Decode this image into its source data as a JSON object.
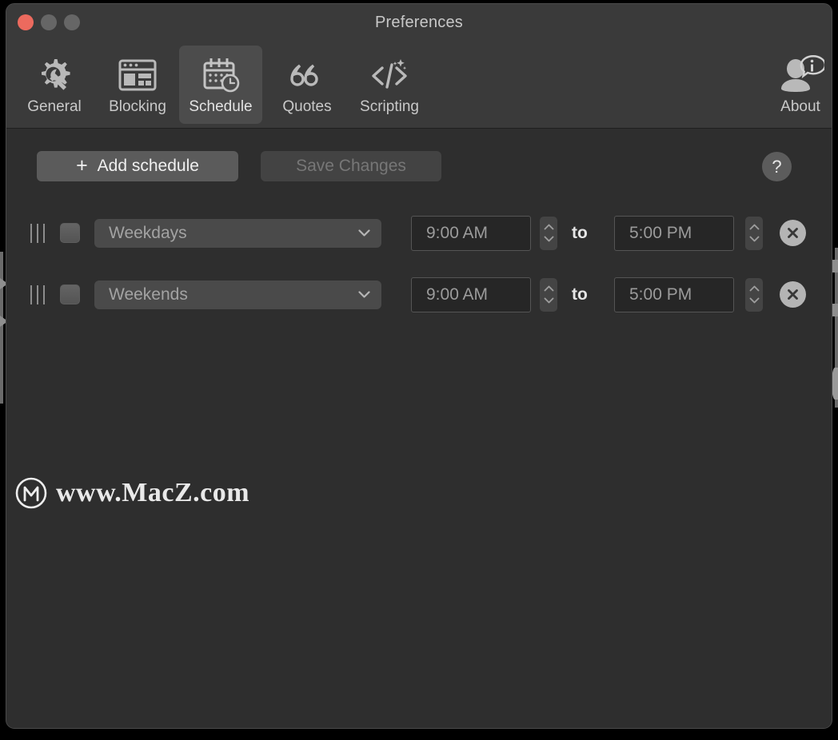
{
  "window": {
    "title": "Preferences",
    "traffic_lights": [
      {
        "name": "close",
        "color": "#ec6a5e"
      },
      {
        "name": "minimize",
        "color": "#666666"
      },
      {
        "name": "maximize",
        "color": "#666666"
      }
    ]
  },
  "toolbar": {
    "selected": "Schedule",
    "items": [
      {
        "label": "General",
        "icon": "gear-wrench-icon",
        "selected": false
      },
      {
        "label": "Blocking",
        "icon": "browser-window-icon",
        "selected": false
      },
      {
        "label": "Schedule",
        "icon": "calendar-clock-icon",
        "selected": true
      },
      {
        "label": "Quotes",
        "icon": "quotation-mark-icon",
        "selected": false
      },
      {
        "label": "Scripting",
        "icon": "code-sparkle-icon",
        "selected": false
      }
    ],
    "about": {
      "label": "About",
      "icon": "person-info-icon"
    }
  },
  "actions": {
    "add_schedule_label": "Add schedule",
    "add_schedule_plus": "+",
    "save_changes_label": "Save Changes",
    "save_changes_enabled": false,
    "help_label": "?"
  },
  "schedule": {
    "rows": [
      {
        "enabled": false,
        "days": "Weekdays",
        "start_time": "9:00 AM",
        "separator": "to",
        "end_time": "5:00 PM"
      },
      {
        "enabled": false,
        "days": "Weekends",
        "start_time": "9:00 AM",
        "separator": "to",
        "end_time": "5:00 PM"
      }
    ]
  },
  "watermark": {
    "text": "www.MacZ.com",
    "logo_letter": "M"
  },
  "colors": {
    "window_bg": "#333333",
    "content_bg": "#2e2e2e",
    "titlebar_bg": "#3a3a3a",
    "accent_close": "#ec6a5e",
    "selected_tab_bg": "#4c4c4c",
    "button_bg": "#5b5b5b",
    "field_bg": "#262626"
  }
}
